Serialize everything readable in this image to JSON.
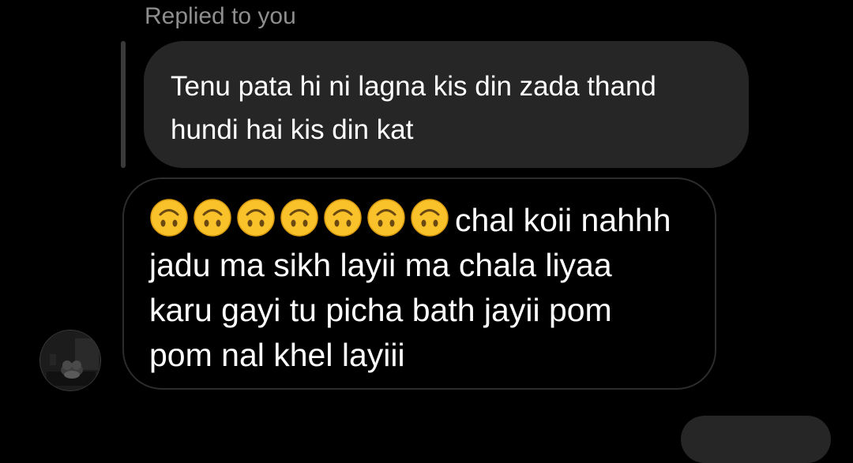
{
  "reply": {
    "label": "Replied to you",
    "quoted_lines": [
      "Tenu pata hi ni lagna kis din zada thand",
      "hundi hai kis din kat"
    ]
  },
  "message": {
    "emoji_name": "upside-down-face-emoji",
    "emoji_count": 7,
    "first_line_text": "chal koii nahhh",
    "lines": [
      "jadu ma sikh layii ma chala liyaa",
      "karu gayi tu picha bath jayii pom",
      "pom nal khel layiii"
    ]
  },
  "sender": {
    "avatar_icon": "profile-photo-avatar"
  },
  "colors": {
    "background": "#000000",
    "quoted_bubble": "#262626",
    "bubble_border": "#2c2c2c",
    "label_gray": "#8e8e8e",
    "emoji_yellow": "#f9c22b"
  }
}
